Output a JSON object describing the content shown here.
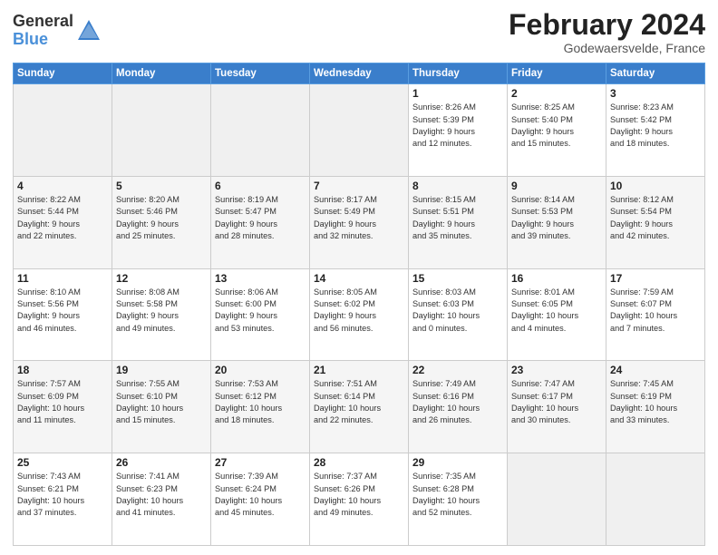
{
  "header": {
    "logo_general": "General",
    "logo_blue": "Blue",
    "month_title": "February 2024",
    "location": "Godewaersvelde, France"
  },
  "days_of_week": [
    "Sunday",
    "Monday",
    "Tuesday",
    "Wednesday",
    "Thursday",
    "Friday",
    "Saturday"
  ],
  "weeks": [
    [
      {
        "day": "",
        "info": ""
      },
      {
        "day": "",
        "info": ""
      },
      {
        "day": "",
        "info": ""
      },
      {
        "day": "",
        "info": ""
      },
      {
        "day": "1",
        "info": "Sunrise: 8:26 AM\nSunset: 5:39 PM\nDaylight: 9 hours\nand 12 minutes."
      },
      {
        "day": "2",
        "info": "Sunrise: 8:25 AM\nSunset: 5:40 PM\nDaylight: 9 hours\nand 15 minutes."
      },
      {
        "day": "3",
        "info": "Sunrise: 8:23 AM\nSunset: 5:42 PM\nDaylight: 9 hours\nand 18 minutes."
      }
    ],
    [
      {
        "day": "4",
        "info": "Sunrise: 8:22 AM\nSunset: 5:44 PM\nDaylight: 9 hours\nand 22 minutes."
      },
      {
        "day": "5",
        "info": "Sunrise: 8:20 AM\nSunset: 5:46 PM\nDaylight: 9 hours\nand 25 minutes."
      },
      {
        "day": "6",
        "info": "Sunrise: 8:19 AM\nSunset: 5:47 PM\nDaylight: 9 hours\nand 28 minutes."
      },
      {
        "day": "7",
        "info": "Sunrise: 8:17 AM\nSunset: 5:49 PM\nDaylight: 9 hours\nand 32 minutes."
      },
      {
        "day": "8",
        "info": "Sunrise: 8:15 AM\nSunset: 5:51 PM\nDaylight: 9 hours\nand 35 minutes."
      },
      {
        "day": "9",
        "info": "Sunrise: 8:14 AM\nSunset: 5:53 PM\nDaylight: 9 hours\nand 39 minutes."
      },
      {
        "day": "10",
        "info": "Sunrise: 8:12 AM\nSunset: 5:54 PM\nDaylight: 9 hours\nand 42 minutes."
      }
    ],
    [
      {
        "day": "11",
        "info": "Sunrise: 8:10 AM\nSunset: 5:56 PM\nDaylight: 9 hours\nand 46 minutes."
      },
      {
        "day": "12",
        "info": "Sunrise: 8:08 AM\nSunset: 5:58 PM\nDaylight: 9 hours\nand 49 minutes."
      },
      {
        "day": "13",
        "info": "Sunrise: 8:06 AM\nSunset: 6:00 PM\nDaylight: 9 hours\nand 53 minutes."
      },
      {
        "day": "14",
        "info": "Sunrise: 8:05 AM\nSunset: 6:02 PM\nDaylight: 9 hours\nand 56 minutes."
      },
      {
        "day": "15",
        "info": "Sunrise: 8:03 AM\nSunset: 6:03 PM\nDaylight: 10 hours\nand 0 minutes."
      },
      {
        "day": "16",
        "info": "Sunrise: 8:01 AM\nSunset: 6:05 PM\nDaylight: 10 hours\nand 4 minutes."
      },
      {
        "day": "17",
        "info": "Sunrise: 7:59 AM\nSunset: 6:07 PM\nDaylight: 10 hours\nand 7 minutes."
      }
    ],
    [
      {
        "day": "18",
        "info": "Sunrise: 7:57 AM\nSunset: 6:09 PM\nDaylight: 10 hours\nand 11 minutes."
      },
      {
        "day": "19",
        "info": "Sunrise: 7:55 AM\nSunset: 6:10 PM\nDaylight: 10 hours\nand 15 minutes."
      },
      {
        "day": "20",
        "info": "Sunrise: 7:53 AM\nSunset: 6:12 PM\nDaylight: 10 hours\nand 18 minutes."
      },
      {
        "day": "21",
        "info": "Sunrise: 7:51 AM\nSunset: 6:14 PM\nDaylight: 10 hours\nand 22 minutes."
      },
      {
        "day": "22",
        "info": "Sunrise: 7:49 AM\nSunset: 6:16 PM\nDaylight: 10 hours\nand 26 minutes."
      },
      {
        "day": "23",
        "info": "Sunrise: 7:47 AM\nSunset: 6:17 PM\nDaylight: 10 hours\nand 30 minutes."
      },
      {
        "day": "24",
        "info": "Sunrise: 7:45 AM\nSunset: 6:19 PM\nDaylight: 10 hours\nand 33 minutes."
      }
    ],
    [
      {
        "day": "25",
        "info": "Sunrise: 7:43 AM\nSunset: 6:21 PM\nDaylight: 10 hours\nand 37 minutes."
      },
      {
        "day": "26",
        "info": "Sunrise: 7:41 AM\nSunset: 6:23 PM\nDaylight: 10 hours\nand 41 minutes."
      },
      {
        "day": "27",
        "info": "Sunrise: 7:39 AM\nSunset: 6:24 PM\nDaylight: 10 hours\nand 45 minutes."
      },
      {
        "day": "28",
        "info": "Sunrise: 7:37 AM\nSunset: 6:26 PM\nDaylight: 10 hours\nand 49 minutes."
      },
      {
        "day": "29",
        "info": "Sunrise: 7:35 AM\nSunset: 6:28 PM\nDaylight: 10 hours\nand 52 minutes."
      },
      {
        "day": "",
        "info": ""
      },
      {
        "day": "",
        "info": ""
      }
    ]
  ]
}
